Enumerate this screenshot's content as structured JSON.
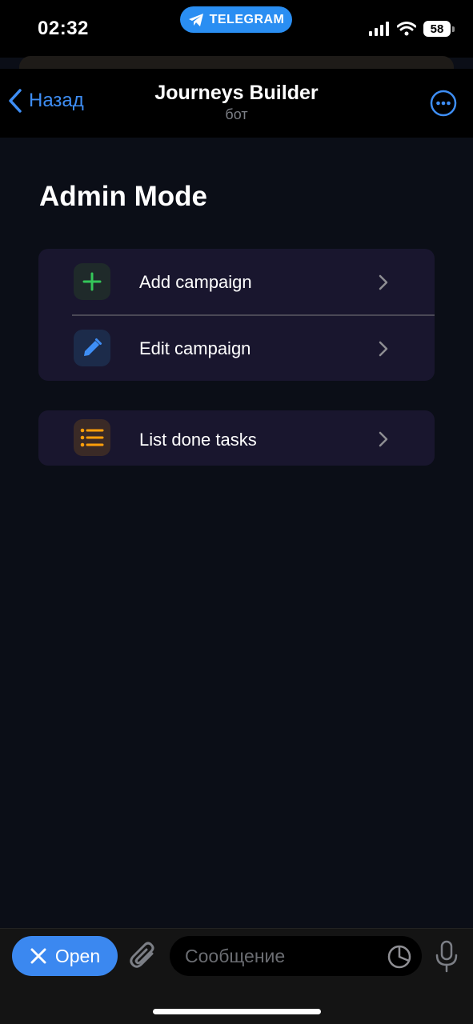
{
  "status_bar": {
    "time": "02:32",
    "app_pill": "TELEGRAM",
    "battery": "58"
  },
  "header": {
    "back_label": "Назад",
    "title": "Journeys Builder",
    "subtitle": "бот"
  },
  "main": {
    "title": "Admin Mode",
    "groups": [
      {
        "items": [
          {
            "label": "Add campaign",
            "icon": "plus-icon",
            "icon_color": "#34c759",
            "icon_bg": "#1f2a2a"
          },
          {
            "label": "Edit campaign",
            "icon": "pencil-icon",
            "icon_color": "#3e8ef5",
            "icon_bg": "#1c2b4a"
          }
        ]
      },
      {
        "items": [
          {
            "label": "List done tasks",
            "icon": "list-icon",
            "icon_color": "#ff9f0a",
            "icon_bg": "#3a2a26"
          }
        ]
      }
    ]
  },
  "bottom_bar": {
    "open_label": "Open",
    "message_placeholder": "Сообщение"
  },
  "colors": {
    "accent": "#3b88f0",
    "background": "#0b0e17",
    "card": "#19162e"
  }
}
